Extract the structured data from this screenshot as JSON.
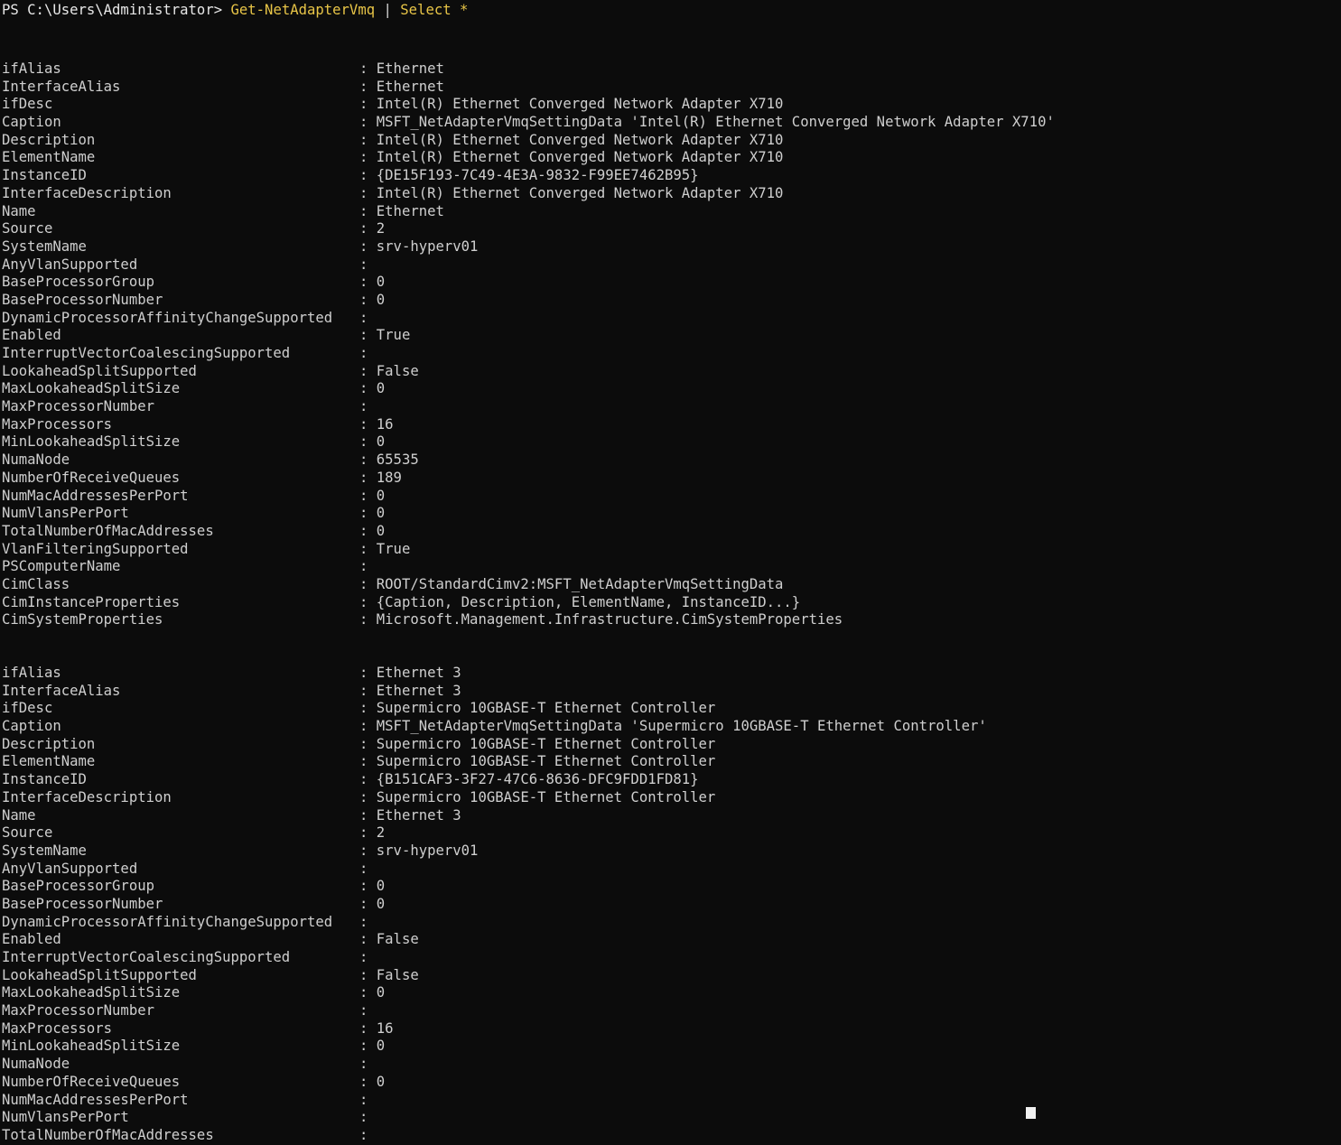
{
  "terminal": {
    "shell": "PowerShell",
    "background_color": "#0c0c0c",
    "text_color": "#cfcfcf",
    "command_color": "#e8c547",
    "prompt": "PS C:\\Users\\Administrator>",
    "command": "Get-NetAdapterVmq",
    "pipe": " | ",
    "command_tail": "Select *",
    "cursor": "█"
  },
  "blocks": [
    {
      "name": "adapter-ethernet",
      "rows": [
        {
          "property": "ifAlias",
          "value": "Ethernet"
        },
        {
          "property": "InterfaceAlias",
          "value": "Ethernet"
        },
        {
          "property": "ifDesc",
          "value": "Intel(R) Ethernet Converged Network Adapter X710"
        },
        {
          "property": "Caption",
          "value": "MSFT_NetAdapterVmqSettingData 'Intel(R) Ethernet Converged Network Adapter X710'"
        },
        {
          "property": "Description",
          "value": "Intel(R) Ethernet Converged Network Adapter X710"
        },
        {
          "property": "ElementName",
          "value": "Intel(R) Ethernet Converged Network Adapter X710"
        },
        {
          "property": "InstanceID",
          "value": "{DE15F193-7C49-4E3A-9832-F99EE7462B95}"
        },
        {
          "property": "InterfaceDescription",
          "value": "Intel(R) Ethernet Converged Network Adapter X710"
        },
        {
          "property": "Name",
          "value": "Ethernet"
        },
        {
          "property": "Source",
          "value": "2"
        },
        {
          "property": "SystemName",
          "value": "srv-hyperv01"
        },
        {
          "property": "AnyVlanSupported",
          "value": ""
        },
        {
          "property": "BaseProcessorGroup",
          "value": "0"
        },
        {
          "property": "BaseProcessorNumber",
          "value": "0"
        },
        {
          "property": "DynamicProcessorAffinityChangeSupported",
          "value": ""
        },
        {
          "property": "Enabled",
          "value": "True"
        },
        {
          "property": "InterruptVectorCoalescingSupported",
          "value": ""
        },
        {
          "property": "LookaheadSplitSupported",
          "value": "False"
        },
        {
          "property": "MaxLookaheadSplitSize",
          "value": "0"
        },
        {
          "property": "MaxProcessorNumber",
          "value": ""
        },
        {
          "property": "MaxProcessors",
          "value": "16"
        },
        {
          "property": "MinLookaheadSplitSize",
          "value": "0"
        },
        {
          "property": "NumaNode",
          "value": "65535"
        },
        {
          "property": "NumberOfReceiveQueues",
          "value": "189"
        },
        {
          "property": "NumMacAddressesPerPort",
          "value": "0"
        },
        {
          "property": "NumVlansPerPort",
          "value": "0"
        },
        {
          "property": "TotalNumberOfMacAddresses",
          "value": "0"
        },
        {
          "property": "VlanFilteringSupported",
          "value": "True"
        },
        {
          "property": "PSComputerName",
          "value": ""
        },
        {
          "property": "CimClass",
          "value": "ROOT/StandardCimv2:MSFT_NetAdapterVmqSettingData"
        },
        {
          "property": "CimInstanceProperties",
          "value": "{Caption, Description, ElementName, InstanceID...}"
        },
        {
          "property": "CimSystemProperties",
          "value": "Microsoft.Management.Infrastructure.CimSystemProperties"
        }
      ]
    },
    {
      "name": "adapter-ethernet-3",
      "rows": [
        {
          "property": "ifAlias",
          "value": "Ethernet 3"
        },
        {
          "property": "InterfaceAlias",
          "value": "Ethernet 3"
        },
        {
          "property": "ifDesc",
          "value": "Supermicro 10GBASE-T Ethernet Controller"
        },
        {
          "property": "Caption",
          "value": "MSFT_NetAdapterVmqSettingData 'Supermicro 10GBASE-T Ethernet Controller'"
        },
        {
          "property": "Description",
          "value": "Supermicro 10GBASE-T Ethernet Controller"
        },
        {
          "property": "ElementName",
          "value": "Supermicro 10GBASE-T Ethernet Controller"
        },
        {
          "property": "InstanceID",
          "value": "{B151CAF3-3F27-47C6-8636-DFC9FDD1FD81}"
        },
        {
          "property": "InterfaceDescription",
          "value": "Supermicro 10GBASE-T Ethernet Controller"
        },
        {
          "property": "Name",
          "value": "Ethernet 3"
        },
        {
          "property": "Source",
          "value": "2"
        },
        {
          "property": "SystemName",
          "value": "srv-hyperv01"
        },
        {
          "property": "AnyVlanSupported",
          "value": ""
        },
        {
          "property": "BaseProcessorGroup",
          "value": "0"
        },
        {
          "property": "BaseProcessorNumber",
          "value": "0"
        },
        {
          "property": "DynamicProcessorAffinityChangeSupported",
          "value": ""
        },
        {
          "property": "Enabled",
          "value": "False"
        },
        {
          "property": "InterruptVectorCoalescingSupported",
          "value": ""
        },
        {
          "property": "LookaheadSplitSupported",
          "value": "False"
        },
        {
          "property": "MaxLookaheadSplitSize",
          "value": "0"
        },
        {
          "property": "MaxProcessorNumber",
          "value": ""
        },
        {
          "property": "MaxProcessors",
          "value": "16"
        },
        {
          "property": "MinLookaheadSplitSize",
          "value": "0"
        },
        {
          "property": "NumaNode",
          "value": ""
        },
        {
          "property": "NumberOfReceiveQueues",
          "value": "0"
        },
        {
          "property": "NumMacAddressesPerPort",
          "value": ""
        },
        {
          "property": "NumVlansPerPort",
          "value": ""
        },
        {
          "property": "TotalNumberOfMacAddresses",
          "value": ""
        }
      ]
    }
  ]
}
